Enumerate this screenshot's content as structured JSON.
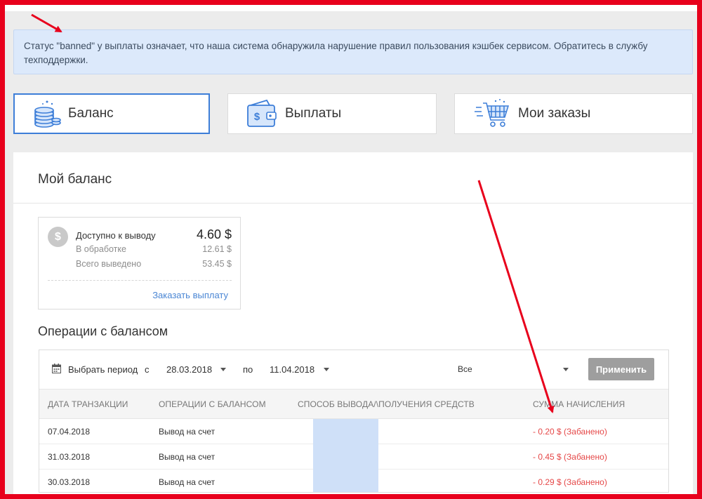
{
  "notice": {
    "text": "Статус \"banned\" у выплаты означает, что наша система обнаружила нарушение правил пользования кэшбек сервисом. Обратитесь в службу техподдержки."
  },
  "tabs": [
    {
      "label": "Баланс",
      "icon": "coins-stack-icon",
      "active": true
    },
    {
      "label": "Выплаты",
      "icon": "wallet-icon",
      "active": false
    },
    {
      "label": "Мои заказы",
      "icon": "shopping-cart-icon",
      "active": false
    }
  ],
  "balance": {
    "title": "Мой баланс",
    "coin_symbol": "$",
    "available_label": "Доступно к выводу",
    "available_value": "4.60 $",
    "processing_label": "В обработке",
    "processing_value": "12.61 $",
    "withdrawn_label": "Всего выведено",
    "withdrawn_value": "53.45 $",
    "order_link": "Заказать выплату"
  },
  "operations": {
    "title": "Операции с балансом",
    "filter": {
      "period_label": "Выбрать период",
      "from_label": "с",
      "from_value": "28.03.2018",
      "to_label": "по",
      "to_value": "11.04.2018",
      "type_value": "Все",
      "apply_button": "Применить"
    },
    "columns": [
      "ДАТА ТРАНЗАКЦИИ",
      "ОПЕРАЦИИ С БАЛАНСОМ",
      "СПОСОБ ВЫВОДА/\\ПОЛУЧЕНИЯ СРЕДСТВ",
      "СУММА НАЧИСЛЕНИЯ"
    ],
    "rows": [
      {
        "date": "07.04.2018",
        "operation": "Вывод на счет",
        "method": "",
        "amount": "- 0.20 $ (Забанено)"
      },
      {
        "date": "31.03.2018",
        "operation": "Вывод на счет",
        "method": "",
        "amount": "- 0.45 $ (Забанено)"
      },
      {
        "date": "30.03.2018",
        "operation": "Вывод на счет",
        "method": "",
        "amount": "- 0.29 $ (Забанено)"
      }
    ]
  },
  "colors": {
    "frame_border": "#e8001c",
    "accent_blue": "#3d7ed8",
    "banned_red": "#e54848",
    "notice_bg": "#dce9fb"
  }
}
